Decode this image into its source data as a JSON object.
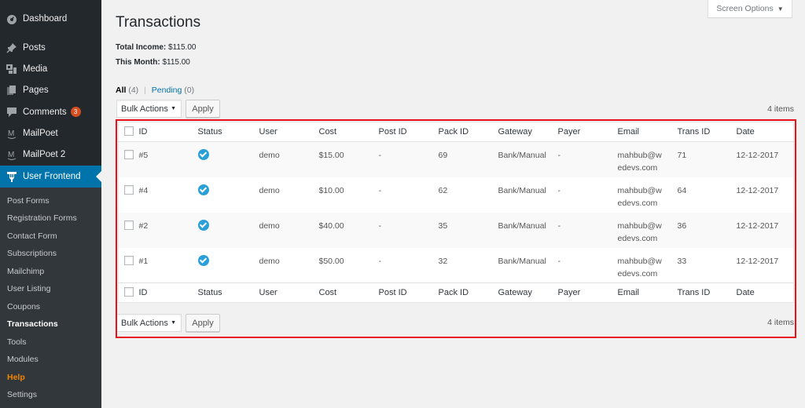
{
  "sidebar": {
    "items": [
      {
        "label": "Dashboard",
        "icon": "dashboard-icon"
      },
      {
        "label": "Posts",
        "icon": "pin-icon"
      },
      {
        "label": "Media",
        "icon": "media-icon"
      },
      {
        "label": "Pages",
        "icon": "pages-icon"
      },
      {
        "label": "Comments",
        "icon": "comment-icon",
        "badge": "3"
      },
      {
        "label": "MailPoet",
        "icon": "mailpoet-icon"
      },
      {
        "label": "MailPoet 2",
        "icon": "mailpoet-icon"
      },
      {
        "label": "User Frontend",
        "icon": "user-frontend-icon",
        "active": true
      }
    ],
    "submenu": [
      {
        "label": "Post Forms"
      },
      {
        "label": "Registration Forms"
      },
      {
        "label": "Contact Form"
      },
      {
        "label": "Subscriptions"
      },
      {
        "label": "Mailchimp"
      },
      {
        "label": "User Listing"
      },
      {
        "label": "Coupons"
      },
      {
        "label": "Transactions",
        "current": true
      },
      {
        "label": "Tools"
      },
      {
        "label": "Modules"
      },
      {
        "label": "Help"
      },
      {
        "label": "Settings"
      }
    ]
  },
  "header": {
    "title": "Transactions",
    "screen_options": "Screen Options"
  },
  "stats": {
    "total_income_label": "Total Income:",
    "total_income_value": "$115.00",
    "this_month_label": "This Month:",
    "this_month_value": "$115.00"
  },
  "filters": {
    "all_label": "All",
    "all_count": "(4)",
    "separator": "|",
    "pending_label": "Pending",
    "pending_count": "(0)"
  },
  "tablenav": {
    "bulk_actions": "Bulk Actions",
    "apply": "Apply",
    "items_count": "4 items"
  },
  "table": {
    "columns": [
      "ID",
      "Status",
      "User",
      "Cost",
      "Post ID",
      "Pack ID",
      "Gateway",
      "Payer",
      "Email",
      "Trans ID",
      "Date"
    ],
    "rows": [
      {
        "id": "#5",
        "status": "completed",
        "user": "demo",
        "cost": "$15.00",
        "post_id": "-",
        "pack_id": "69",
        "gateway": "Bank/Manual",
        "payer": "-",
        "email": "mahbub@wedevs.com",
        "trans_id": "71",
        "date": "12-12-2017"
      },
      {
        "id": "#4",
        "status": "completed",
        "user": "demo",
        "cost": "$10.00",
        "post_id": "-",
        "pack_id": "62",
        "gateway": "Bank/Manual",
        "payer": "-",
        "email": "mahbub@wedevs.com",
        "trans_id": "64",
        "date": "12-12-2017"
      },
      {
        "id": "#2",
        "status": "completed",
        "user": "demo",
        "cost": "$40.00",
        "post_id": "-",
        "pack_id": "35",
        "gateway": "Bank/Manual",
        "payer": "-",
        "email": "mahbub@wedevs.com",
        "trans_id": "36",
        "date": "12-12-2017"
      },
      {
        "id": "#1",
        "status": "completed",
        "user": "demo",
        "cost": "$50.00",
        "post_id": "-",
        "pack_id": "32",
        "gateway": "Bank/Manual",
        "payer": "-",
        "email": "mahbub@wedevs.com",
        "trans_id": "33",
        "date": "12-12-2017"
      }
    ]
  },
  "colors": {
    "sidebar_bg": "#23282d",
    "submenu_bg": "#32373c",
    "active_bg": "#0073aa",
    "link": "#0073aa",
    "badge": "#d54e21",
    "help": "#f18500",
    "status_check": "#2a9fd8",
    "highlight_frame": "#e8101a"
  }
}
